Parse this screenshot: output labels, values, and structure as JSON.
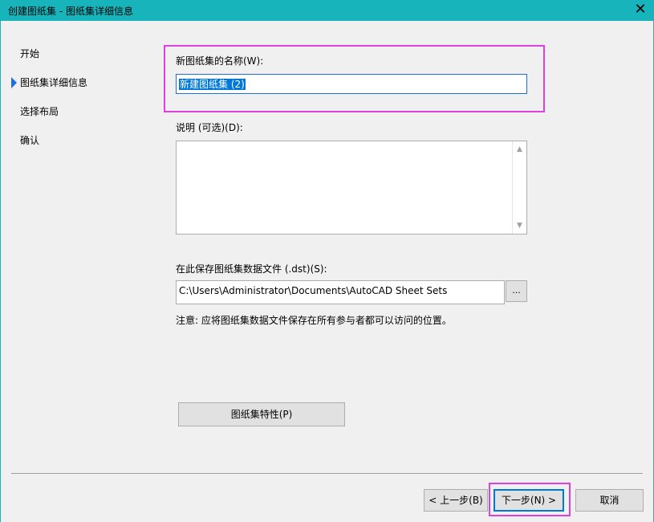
{
  "window": {
    "title": "创建图纸集 - 图纸集详细信息",
    "close_glyph": "✕"
  },
  "nav": {
    "items": [
      {
        "label": "开始",
        "active": false
      },
      {
        "label": "图纸集详细信息",
        "active": true
      },
      {
        "label": "选择布局",
        "active": false
      },
      {
        "label": "确认",
        "active": false
      }
    ]
  },
  "form": {
    "name_label": "新图纸集的名称(W):",
    "name_value": "新建图纸集 (2)",
    "description_label": "说明 (可选)(D):",
    "description_value": "",
    "save_path_label": "在此保存图纸集数据文件 (.dst)(S):",
    "save_path_value": "C:\\Users\\Administrator\\Documents\\AutoCAD Sheet Sets",
    "browse_label": "...",
    "note": "注意: 应将图纸集数据文件保存在所有参与者都可以访问的位置。",
    "properties_button": "图纸集特性(P)"
  },
  "footer": {
    "back_button": "< 上一步(B)",
    "next_button": "下一步(N) >",
    "cancel_button": "取消"
  },
  "colors": {
    "titlebar": "#17b5bb",
    "highlight": "#e040e0",
    "accent": "#0078d7"
  },
  "icons": {
    "close": "close-icon",
    "nav_arrow": "triangle-right-icon",
    "scroll_up": "scroll-up-icon",
    "scroll_down": "scroll-down-icon"
  }
}
